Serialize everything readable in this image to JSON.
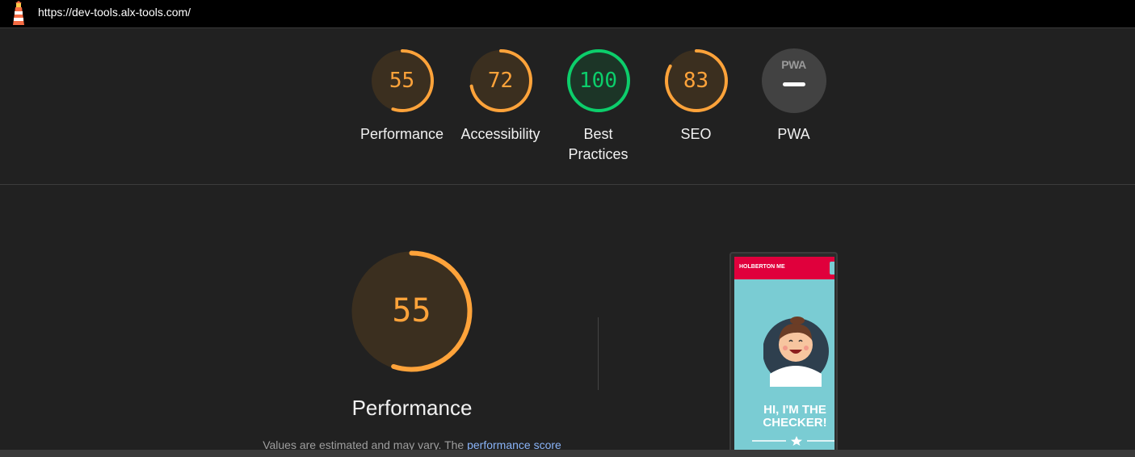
{
  "header": {
    "url": "https://dev-tools.alx-tools.com/",
    "logo_icon": "lighthouse-icon"
  },
  "scores": [
    {
      "key": "performance",
      "value": "55",
      "label": "Performance",
      "fraction": 0.55,
      "rating": "average",
      "color": "#ffa33a"
    },
    {
      "key": "accessibility",
      "value": "72",
      "label": "Accessibility",
      "fraction": 0.72,
      "rating": "average",
      "color": "#ffa33a"
    },
    {
      "key": "best-practices",
      "value": "100",
      "label": "Best Practices",
      "fraction": 1.0,
      "rating": "pass",
      "color": "#0cce6b"
    },
    {
      "key": "seo",
      "value": "83",
      "label": "SEO",
      "fraction": 0.83,
      "rating": "average",
      "color": "#ffa33a"
    },
    {
      "key": "pwa",
      "value": "",
      "label": "PWA",
      "badge_text": "PWA",
      "fraction": null,
      "rating": "na"
    }
  ],
  "performance_section": {
    "score": "55",
    "fraction": 0.55,
    "title": "Performance",
    "description_prefix": "Values are estimated and may vary. The ",
    "link_text": "performance score"
  },
  "screenshot": {
    "brand": "HOLBERTON ME",
    "hero_line1": "HI, I'M THE",
    "hero_line2": "CHECKER!",
    "icons": [
      "avatar-illustration-icon",
      "star-icon"
    ]
  }
}
